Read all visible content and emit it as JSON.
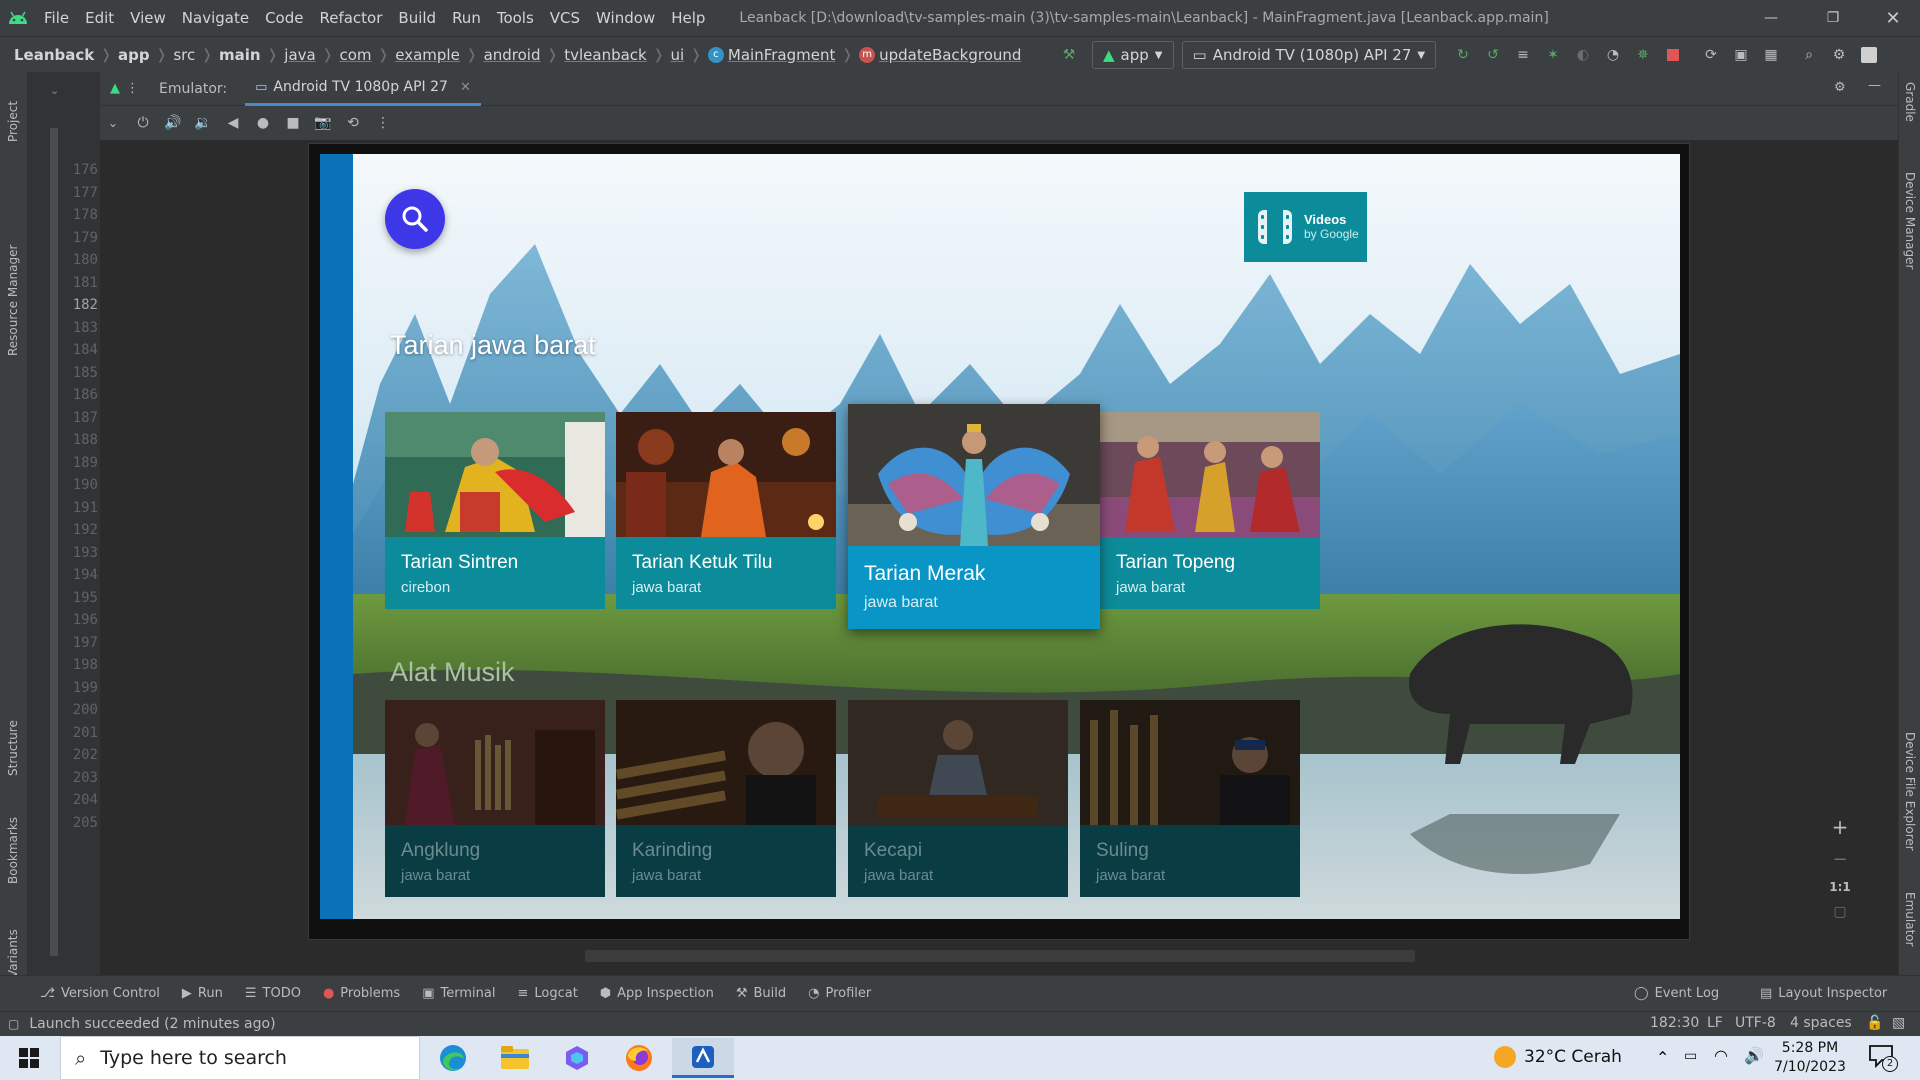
{
  "menu": {
    "items": [
      "File",
      "Edit",
      "View",
      "Navigate",
      "Code",
      "Refactor",
      "Build",
      "Run",
      "Tools",
      "VCS",
      "Window",
      "Help"
    ],
    "window_title": "Leanback [D:\\download\\tv-samples-main (3)\\tv-samples-main\\Leanback] - MainFragment.java [Leanback.app.main]"
  },
  "breadcrumbs": {
    "project": "Leanback",
    "module": "app",
    "path": [
      "src",
      "main",
      "java",
      "com",
      "example",
      "android",
      "tvleanback",
      "ui"
    ],
    "class": "MainFragment",
    "method": "updateBackground"
  },
  "run_config": {
    "module": "app",
    "device": "Android TV (1080p) API 27"
  },
  "emulator": {
    "label": "Emulator:",
    "tab": "Android TV 1080p API 27"
  },
  "gutter": {
    "lines": [
      "176",
      "177",
      "178",
      "179",
      "180",
      "181",
      "182",
      "183",
      "184",
      "185",
      "186",
      "187",
      "188",
      "189",
      "190",
      "191",
      "192",
      "193",
      "194",
      "195",
      "196",
      "197",
      "198",
      "199",
      "200",
      "201",
      "202",
      "203",
      "204",
      "205"
    ],
    "current": "182"
  },
  "tv": {
    "badge_title": "Videos",
    "badge_sub": "by Google",
    "rows": [
      {
        "header": "Tarian jawa barat",
        "cards": [
          {
            "title": "Tarian Sintren",
            "sub": "cirebon"
          },
          {
            "title": "Tarian Ketuk Tilu",
            "sub": "jawa barat"
          },
          {
            "title": "Tarian Merak",
            "sub": "jawa barat"
          },
          {
            "title": "Tarian Topeng",
            "sub": "jawa barat"
          }
        ]
      },
      {
        "header": "Alat Musik",
        "cards": [
          {
            "title": "Angklung",
            "sub": "jawa barat"
          },
          {
            "title": "Karinding",
            "sub": "jawa barat"
          },
          {
            "title": "Kecapi",
            "sub": "jawa barat"
          },
          {
            "title": "Suling",
            "sub": "jawa barat"
          }
        ]
      }
    ]
  },
  "zoom": {
    "ratio": "1:1"
  },
  "side_tabs": {
    "left": [
      "Project",
      "Resource Manager",
      "Structure",
      "Bookmarks",
      "Build Variants"
    ],
    "right": [
      "Gradle",
      "Device Manager",
      "Device File Explorer",
      "Emulator"
    ]
  },
  "bottom_tabs": [
    "Version Control",
    "Run",
    "TODO",
    "Problems",
    "Terminal",
    "Logcat",
    "App Inspection",
    "Build",
    "Profiler"
  ],
  "bottom_right_tabs": [
    "Event Log",
    "Layout Inspector"
  ],
  "status": {
    "message": "Launch succeeded (2 minutes ago)",
    "position": "182:30",
    "line_sep": "LF",
    "encoding": "UTF-8",
    "indent": "4 spaces"
  },
  "taskbar": {
    "search_placeholder": "Type here to search",
    "weather": "32°C  Cerah",
    "time": "5:28 PM",
    "date": "7/10/2023",
    "notifications": "2"
  },
  "colors": {
    "ide_bg": "#2b2d30",
    "tv_accent": "#0b72b8",
    "card_bg": "#0c8b9a",
    "focus_card": "#0996c6",
    "search_orb": "#3d37e8"
  }
}
